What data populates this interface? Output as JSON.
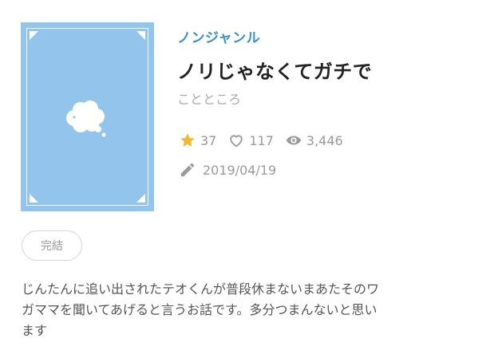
{
  "work": {
    "genre": "ノンジャンル",
    "title": "ノリじゃなくてガチで",
    "author": "ことところ",
    "stars": "37",
    "likes": "117",
    "views": "3,446",
    "date": "2019/04/19",
    "status": "完結",
    "description_lines": [
      "じんたんに追い出されたテオくんが普段休まないまあたそのワ",
      "ガママを聞いてあげると言うお話です。多分つまんないと思い",
      "ます"
    ]
  },
  "icons": {
    "star": "star-icon",
    "heart": "heart-icon",
    "eye": "eye-icon",
    "pencil": "pencil-icon"
  },
  "colors": {
    "cover": "#93c4ec",
    "genre": "#3a8fd1",
    "star": "#f4b731",
    "muted": "#9a9a9a"
  }
}
